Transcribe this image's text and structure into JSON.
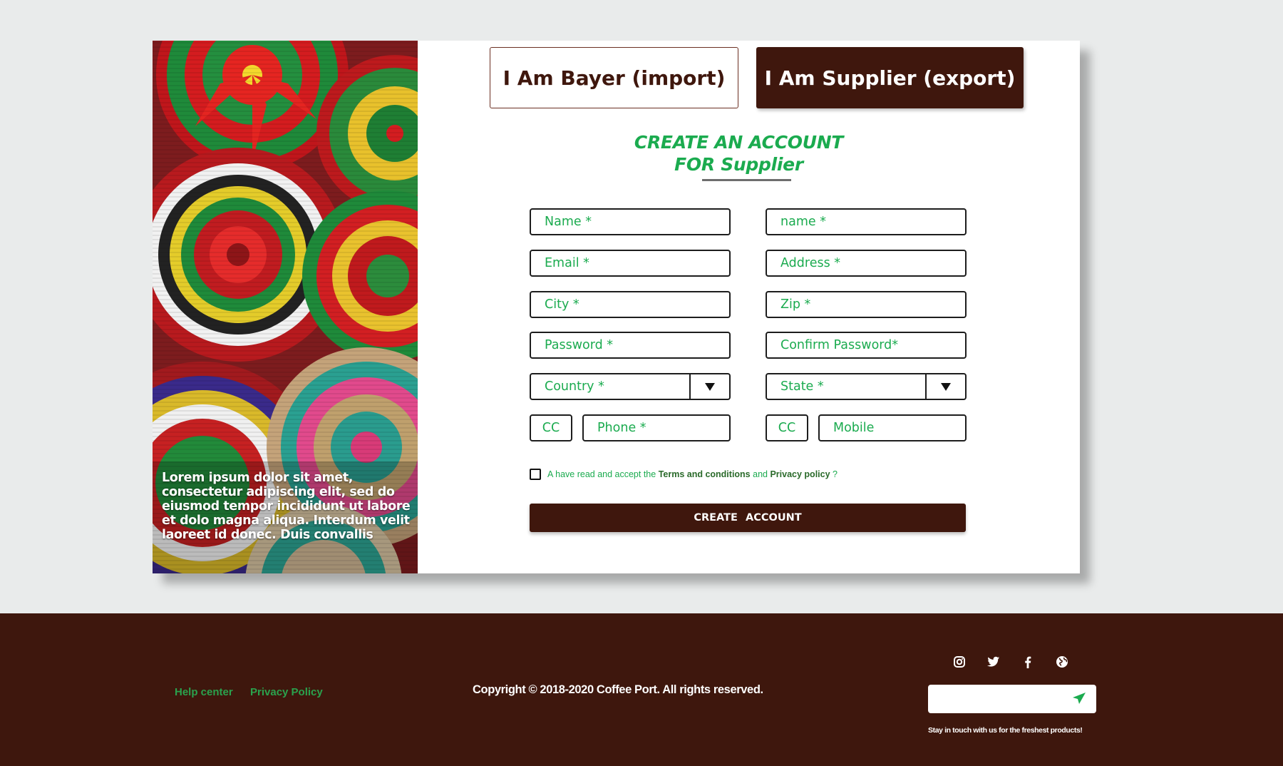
{
  "tabs": {
    "buyer": "I Am Bayer (import)",
    "supplier": "I Am Supplier (export)"
  },
  "heading": {
    "line1": "CREATE AN ACCOUNT",
    "line2": "FOR Supplier"
  },
  "side_panel": {
    "caption": "Lorem ipsum dolor sit amet, consectetur adipiscing elit, sed do eiusmod tempor incididunt ut labore et dolo magna aliqua. Interdum velit laoreet id donec. Duis convallis"
  },
  "form": {
    "first_name": "Name *",
    "last_name": "name *",
    "email": "Email *",
    "address": "Address *",
    "city": "City *",
    "zip": "Zip *",
    "password": "Password *",
    "confirm_password": "Confirm Password*",
    "country": "Country *",
    "state": "State *",
    "phone_cc": "CC",
    "phone": "Phone *",
    "mobile_cc": "CC",
    "mobile": "Mobile"
  },
  "terms": {
    "prefix": "A have read and accept the",
    "terms_link": "Terms and conditions",
    "and": "and",
    "privacy_link": "Privacy policy",
    "suffix": "?"
  },
  "submit_label": "CREATE ACCOUNT",
  "footer": {
    "help_center": "Help center",
    "privacy_policy": "Privacy Policy",
    "copyright": "Copyright © 2018-2020 Coffee Port. All rights reserved.",
    "newsletter_placeholder": "",
    "newsletter_note": "Stay in touch with us for the freshest products!",
    "social_icons": [
      "instagram-icon",
      "twitter-icon",
      "facebook-icon",
      "globe-icon"
    ]
  },
  "colors": {
    "brand_brown": "#3f170d",
    "accent_green": "#1bab4f",
    "page_bg": "#e9ebeb"
  }
}
